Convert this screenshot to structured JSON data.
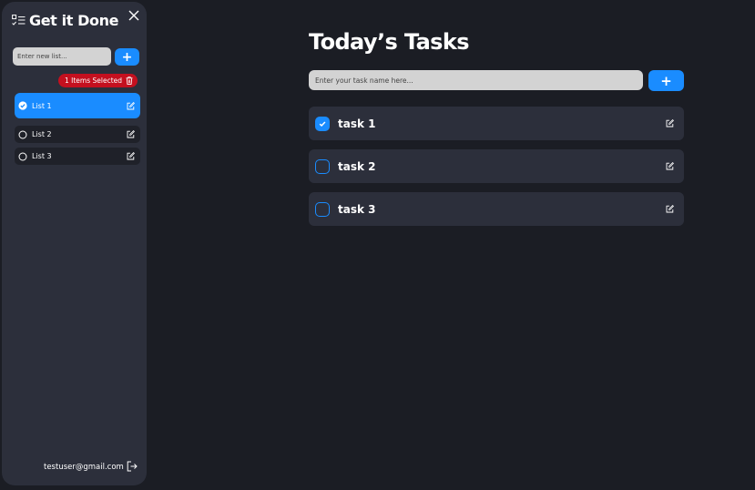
{
  "sidebar": {
    "brand_title": "Get it Done",
    "new_list_placeholder": "Enter new list...",
    "add_list_label": "+",
    "selected_badge": "1 Items Selected",
    "lists": [
      {
        "label": "List 1",
        "active": true
      },
      {
        "label": "List 2",
        "active": false
      },
      {
        "label": "List 3",
        "active": false
      }
    ],
    "user_email": "testuser@gmail.com"
  },
  "main": {
    "title": "Today’s Tasks",
    "task_placeholder": "Enter your task name here...",
    "add_task_label": "+",
    "tasks": [
      {
        "name": "task 1",
        "done": true
      },
      {
        "name": "task 2",
        "done": false
      },
      {
        "name": "task 3",
        "done": false
      }
    ]
  },
  "colors": {
    "background": "#1b1d24",
    "panel": "#2c2f3b",
    "accent": "#1a8cff",
    "danger": "#c4101f",
    "input": "#d3d3d3"
  },
  "icons": [
    "checklist-icon",
    "close-icon",
    "trash-icon",
    "check-icon",
    "edit-icon",
    "logout-icon"
  ]
}
